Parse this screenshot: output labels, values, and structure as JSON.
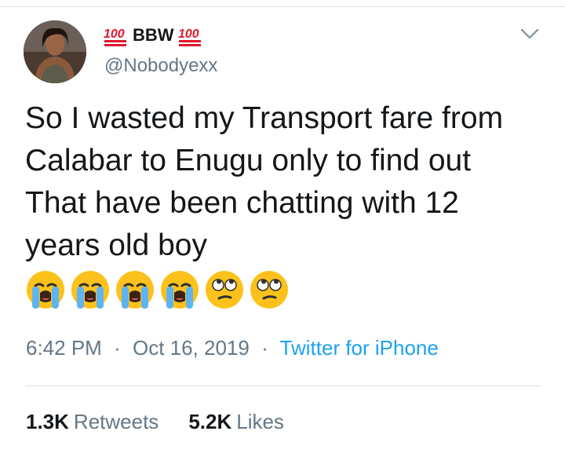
{
  "tweet": {
    "name_emoji_left": "💯",
    "display_name": "BBW",
    "name_emoji_right": "💯",
    "handle": "@Nobodyexx",
    "text": "So I wasted my Transport fare from\nCalabar  to Enugu only to find out\nThat have been chatting with 12\nyears old boy",
    "emojis": [
      "loudly-crying-face",
      "loudly-crying-face",
      "loudly-crying-face",
      "loudly-crying-face",
      "face-with-rolling-eyes",
      "face-with-rolling-eyes"
    ],
    "time": "6:42 PM",
    "separator": "·",
    "date": "Oct 16, 2019",
    "source": "Twitter for iPhone",
    "retweets_count": "1.3K",
    "retweets_label": "Retweets",
    "likes_count": "5.2K",
    "likes_label": "Likes"
  },
  "colors": {
    "text": "#14171a",
    "secondary": "#657786",
    "link": "#1da1f2",
    "divider": "#d9dde1",
    "hundred_red": "#e0182d"
  }
}
